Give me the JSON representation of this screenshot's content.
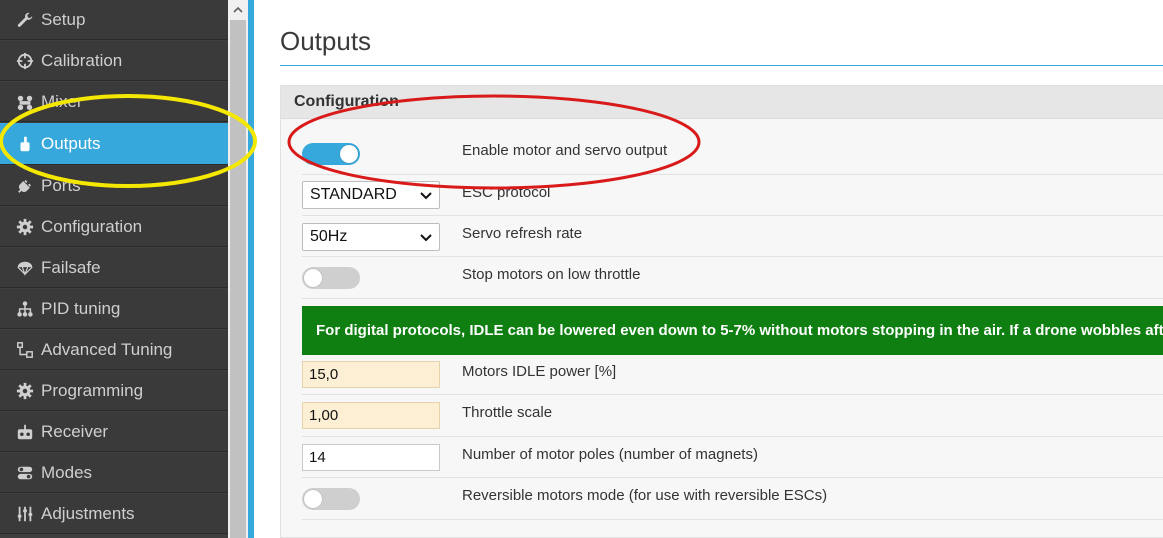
{
  "sidebar": {
    "items": [
      {
        "label": "Setup",
        "icon": "wrench-icon"
      },
      {
        "label": "Calibration",
        "icon": "crosshair-icon"
      },
      {
        "label": "Mixer",
        "icon": "mixer-icon"
      },
      {
        "label": "Outputs",
        "icon": "outputs-icon",
        "active": true
      },
      {
        "label": "Ports",
        "icon": "plug-icon"
      },
      {
        "label": "Configuration",
        "icon": "gear-icon"
      },
      {
        "label": "Failsafe",
        "icon": "parachute-icon"
      },
      {
        "label": "PID tuning",
        "icon": "hierarchy-icon"
      },
      {
        "label": "Advanced Tuning",
        "icon": "tree-icon"
      },
      {
        "label": "Programming",
        "icon": "gear-icon"
      },
      {
        "label": "Receiver",
        "icon": "remote-icon"
      },
      {
        "label": "Modes",
        "icon": "toggle-icon"
      },
      {
        "label": "Adjustments",
        "icon": "sliders-icon"
      }
    ]
  },
  "main": {
    "title": "Outputs",
    "panel_title": "Configuration",
    "rows": {
      "enable_output": {
        "label": "Enable motor and servo output",
        "state": "on"
      },
      "esc_protocol": {
        "label": "ESC protocol",
        "value": "STANDARD"
      },
      "servo_refresh": {
        "label": "Servo refresh rate",
        "value": "50Hz"
      },
      "stop_motors": {
        "label": "Stop motors on low throttle",
        "state": "off"
      },
      "banner": "For digital protocols, IDLE can be lowered even down to 5-7% without motors stopping in the air. If a drone wobbles after",
      "motors_idle": {
        "label": "Motors IDLE power [%]",
        "value": "15,0"
      },
      "throttle_scale": {
        "label": "Throttle scale",
        "value": "1,00"
      },
      "motor_poles": {
        "label": "Number of motor poles (number of magnets)",
        "value": "14"
      },
      "reversible": {
        "label": "Reversible motors mode (for use with reversible ESCs)",
        "state": "off"
      }
    }
  },
  "colors": {
    "sidebar_bg": "#3a3a3a",
    "active_bg": "#37a8db",
    "accent": "#37a8db",
    "banner_bg": "#0f7f12",
    "highlight_input": "#fdefd4",
    "annotation_yellow": "#f5e800",
    "annotation_red": "#d91a1a"
  }
}
